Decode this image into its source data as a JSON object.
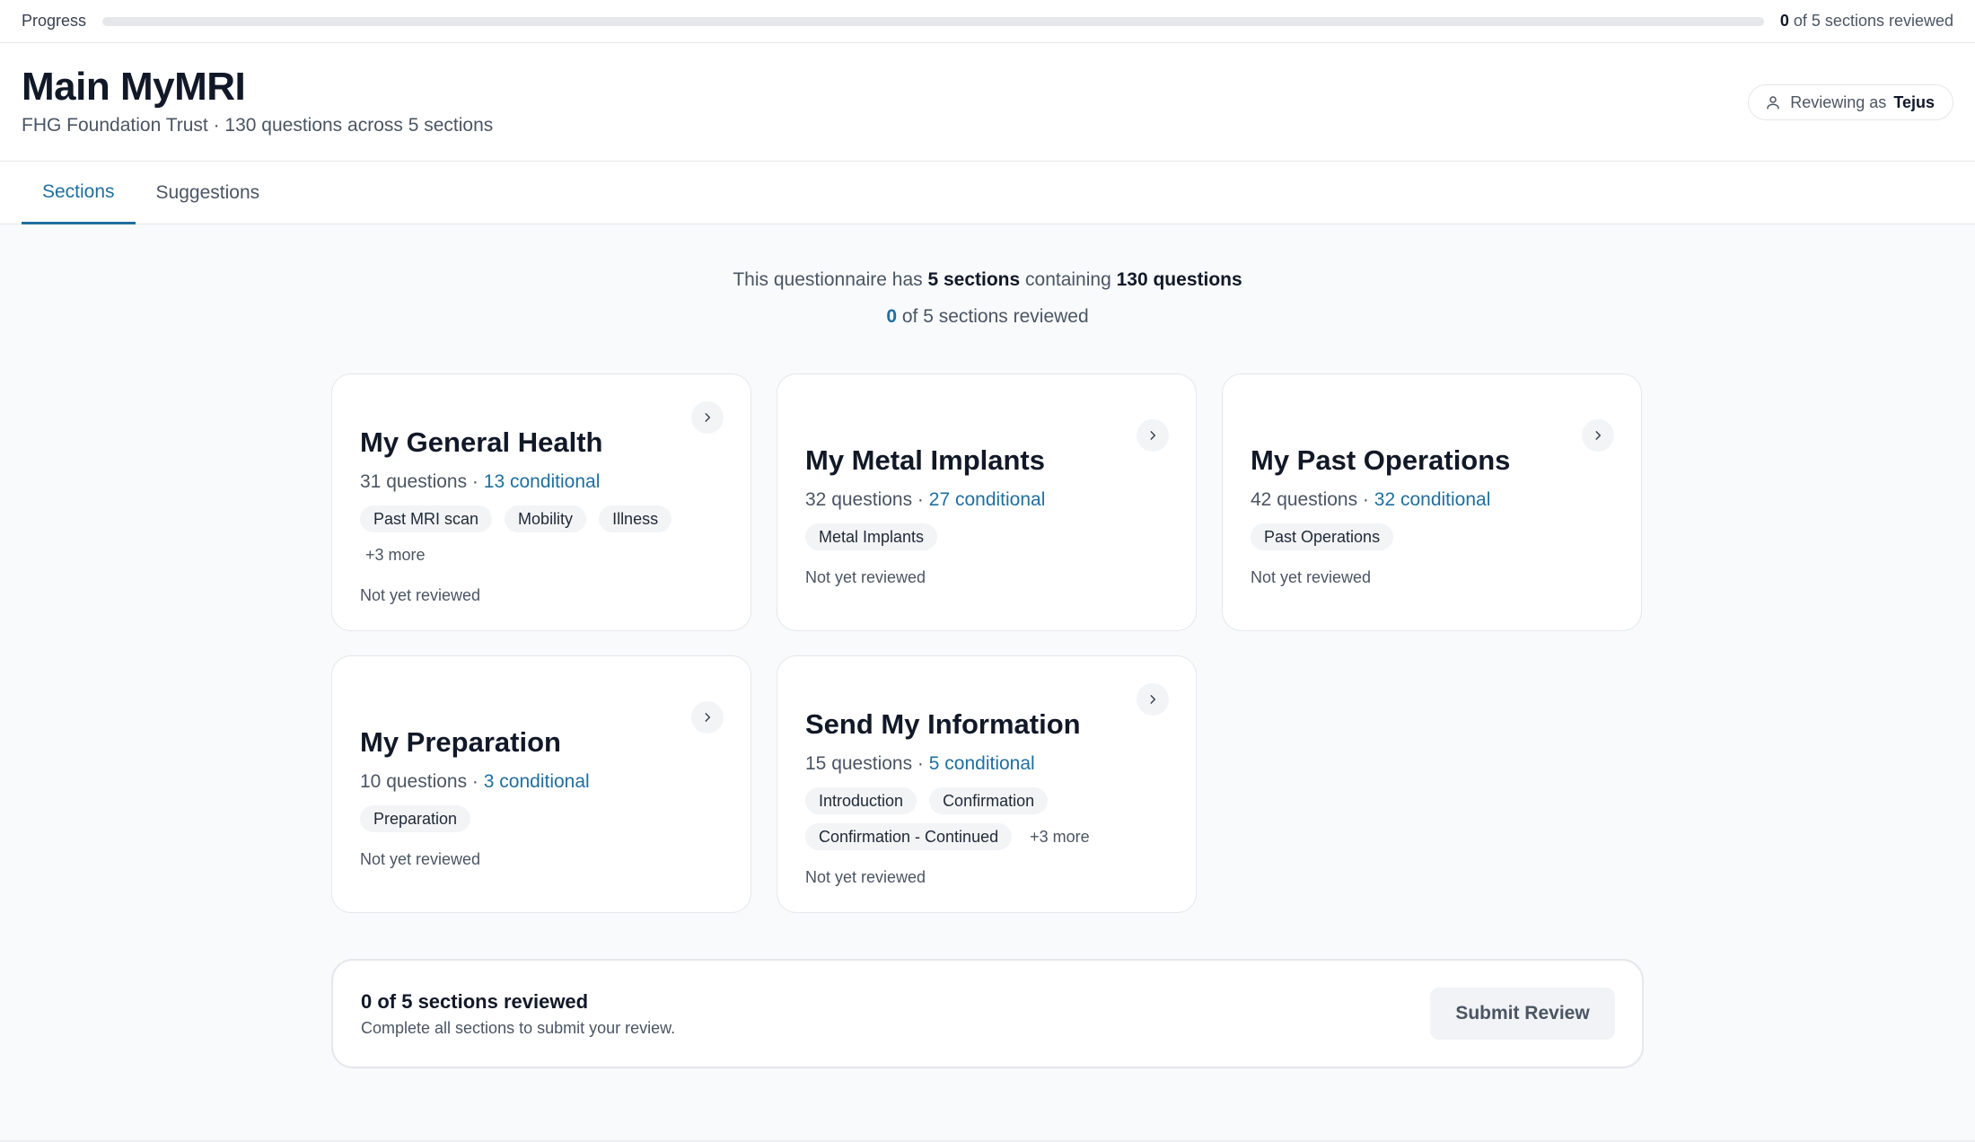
{
  "progress": {
    "label": "Progress",
    "reviewed_count": "0",
    "status_text": " of 5 sections reviewed",
    "fraction": 0
  },
  "header": {
    "title": "Main MyMRI",
    "subtitle": "FHG Foundation Trust · 130 questions across 5 sections",
    "reviewer_prefix": "Reviewing as",
    "reviewer_name": "Tejus"
  },
  "tabs": [
    {
      "label": "Sections",
      "active": true
    },
    {
      "label": "Suggestions",
      "active": false
    }
  ],
  "summary": {
    "line1_prefix": "This questionnaire has ",
    "line1_sections": "5 sections",
    "line1_middle": " containing ",
    "line1_questions": "130 questions",
    "line2_count": "0",
    "line2_suffix": " of 5 sections reviewed"
  },
  "sections": [
    {
      "title": "My General Health",
      "questions": "31 questions · ",
      "conditional": "13 conditional",
      "tags": [
        "Past MRI scan",
        "Mobility",
        "Illness"
      ],
      "more": "+3 more",
      "status": "Not yet reviewed"
    },
    {
      "title": "My Metal Implants",
      "questions": "32 questions · ",
      "conditional": "27 conditional",
      "tags": [
        "Metal Implants"
      ],
      "more": "",
      "status": "Not yet reviewed"
    },
    {
      "title": "My Past Operations",
      "questions": "42 questions · ",
      "conditional": "32 conditional",
      "tags": [
        "Past Operations"
      ],
      "more": "",
      "status": "Not yet reviewed"
    },
    {
      "title": "My Preparation",
      "questions": "10 questions · ",
      "conditional": "3 conditional",
      "tags": [
        "Preparation"
      ],
      "more": "",
      "status": "Not yet reviewed"
    },
    {
      "title": "Send My Information",
      "questions": "15 questions · ",
      "conditional": "5 conditional",
      "tags": [
        "Introduction",
        "Confirmation",
        "Confirmation - Continued"
      ],
      "more": "+3 more",
      "status": "Not yet reviewed"
    }
  ],
  "footer": {
    "title": "0 of 5 sections reviewed",
    "subtitle": "Complete all sections to submit your review.",
    "submit_label": "Submit Review"
  },
  "icons": {
    "reviewer": "user-icon",
    "card_arrow": "chevron-right-icon"
  },
  "colors": {
    "accent": "#1f6f9f",
    "background": "#f8fafc"
  }
}
